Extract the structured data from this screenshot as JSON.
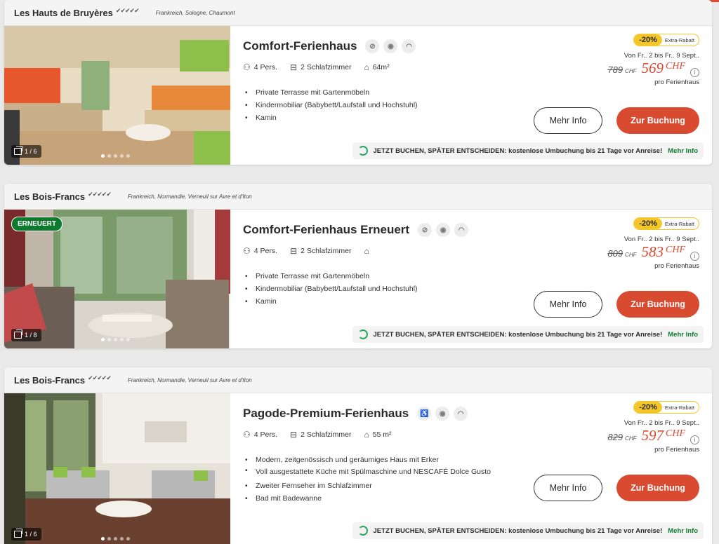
{
  "cards": [
    {
      "park_name": "Les Hauts de Bruyères",
      "stars": "✔✔✔✔✔",
      "location": "Frankreich,  Sologne,  Chaumont",
      "badge": "",
      "photo_counter": "1 / 6",
      "house_title": "Comfort-Ferienhaus",
      "persons": "4 Pers.",
      "bedrooms": "2 Schlafzimmer",
      "area": "64m²",
      "features": [
        "Private Terrasse mit Gartenmöbeln",
        "Kindermobiliar (Babybett/Laufstall und Hochstuhl)",
        "Kamin"
      ],
      "discount": "-20%",
      "discount_label": "Extra-Rabatt",
      "dates": "Von Fr.. 2 bis Fr.. 9 Sept..",
      "old_price": "789",
      "old_currency": "CHF",
      "new_price": "569",
      "new_currency": "CHF",
      "per_unit": "pro Ferienhaus",
      "more_info": "Mehr Info",
      "book": "Zur Buchung",
      "rebook_text": "JETZT BUCHEN, SPÄTER ENTSCHEIDEN: kostenlose Umbuchung bis 21 Tage vor Anreise!",
      "rebook_link": "Mehr Info"
    },
    {
      "park_name": "Les Bois-Francs",
      "stars": "✔✔✔✔✔",
      "location": "Frankreich,  Normandie,  Verneuil sur Avre et d'Iton",
      "badge": "ERNEUERT",
      "photo_counter": "1 / 8",
      "house_title": "Comfort-Ferienhaus Erneuert",
      "persons": "4 Pers.",
      "bedrooms": "2 Schlafzimmer",
      "area": "",
      "features": [
        "Private Terrasse mit Gartenmöbeln",
        "Kindermobiliar (Babybett/Laufstall und Hochstuhl)",
        "Kamin"
      ],
      "discount": "-20%",
      "discount_label": "Extra-Rabatt",
      "dates": "Von Fr.. 2 bis Fr.. 9 Sept..",
      "old_price": "809",
      "old_currency": "CHF",
      "new_price": "583",
      "new_currency": "CHF",
      "per_unit": "pro Ferienhaus",
      "more_info": "Mehr Info",
      "book": "Zur Buchung",
      "rebook_text": "JETZT BUCHEN, SPÄTER ENTSCHEIDEN: kostenlose Umbuchung bis 21 Tage vor Anreise!",
      "rebook_link": "Mehr Info"
    },
    {
      "park_name": "Les Bois-Francs",
      "stars": "✔✔✔✔✔",
      "location": "Frankreich,  Normandie,  Verneuil sur Avre et d'Iton",
      "badge": "",
      "photo_counter": "1 / 6",
      "house_title": "Pagode-Premium-Ferienhaus",
      "persons": "4 Pers.",
      "bedrooms": "2 Schlafzimmer",
      "area": "55 m²",
      "features": [
        "Modern, zeitgenössisch und geräumiges Haus mit Erker",
        "Voll ausgestattete Küche mit Spülmaschine und NESCAFÉ Dolce Gusto",
        "Zweiter Fernseher im Schlafzimmer",
        "Bad mit Badewanne"
      ],
      "discount": "-20%",
      "discount_label": "Extra-Rabatt",
      "dates": "Von Fr.. 2 bis Fr.. 9 Sept..",
      "old_price": "829",
      "old_currency": "CHF",
      "new_price": "597",
      "new_currency": "CHF",
      "per_unit": "pro Ferienhaus",
      "more_info": "Mehr Info",
      "book": "Zur Buchung",
      "rebook_text": "JETZT BUCHEN, SPÄTER ENTSCHEIDEN: kostenlose Umbuchung bis 21 Tage vor Anreise!",
      "rebook_link": "Mehr Info"
    }
  ],
  "icons": {
    "persons": "persons-icon",
    "bedrooms": "bed-icon",
    "area": "house-icon",
    "info": "i",
    "no_smoking": "no-smoking-icon",
    "pet": "pet-icon",
    "wifi": "wifi-icon",
    "accessible": "wheelchair-icon"
  },
  "colors": {
    "accent": "#d94b31",
    "green": "#0e7a2d",
    "discount": "#f3c62a"
  }
}
